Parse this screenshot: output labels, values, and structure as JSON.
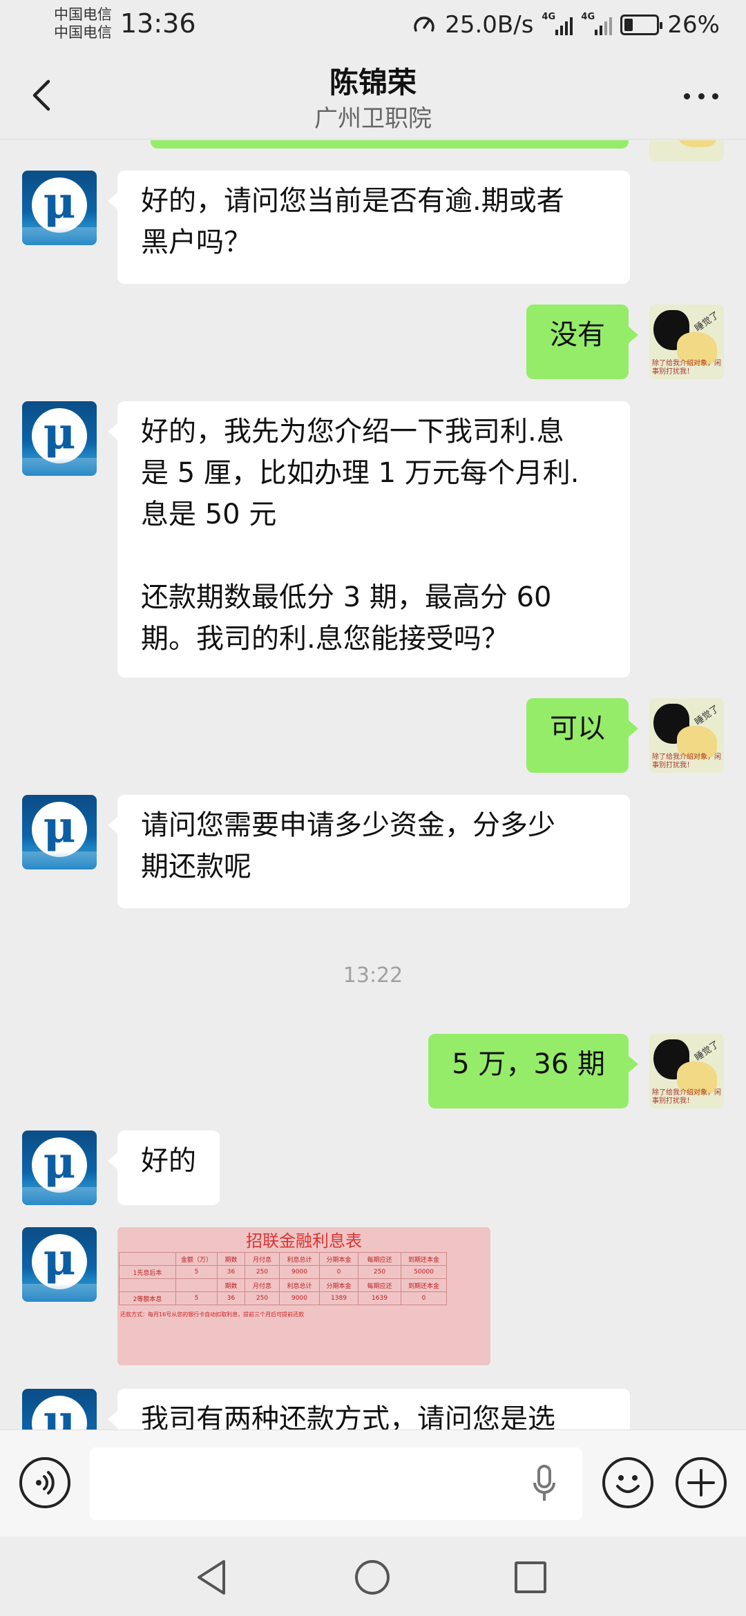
{
  "status_bar": {
    "carrier1": "中国电信",
    "carrier2": "中国电信",
    "time": "13:36",
    "speed": "25.0B/s",
    "network1": "4G",
    "network2": "4G",
    "battery": "26%",
    "battery_level": 0.26
  },
  "header": {
    "title": "陈锦荣",
    "subtitle": "广州卫职院"
  },
  "avatars": {
    "contact_glyph": "μ",
    "user_caption": "除了给我介绍对象，闲事别打扰我！",
    "user_sticker_text": "睡觉了"
  },
  "messages": [
    {
      "side": "left",
      "text": "好的，请问您当前是否有逾.期或者\n黑户吗？"
    },
    {
      "side": "right",
      "text": "没有"
    },
    {
      "side": "left",
      "text": "好的，我先为您介绍一下我司利.息\n是 5 厘，比如办理 1 万元每个月利.\n息是 50 元\n\n还款期数最低分 3 期，最高分 60\n期。我司的利.息您能接受吗？"
    },
    {
      "side": "right",
      "text": "可以"
    },
    {
      "side": "left",
      "text": "请问您需要申请多少资金，分多少\n期还款呢"
    },
    {
      "side": "time",
      "text": "13:22"
    },
    {
      "side": "right",
      "text": "5 万，36 期"
    },
    {
      "side": "left",
      "text": "好的"
    },
    {
      "side": "left",
      "text": "我司有两种还款方式，请问您是选"
    }
  ],
  "rate_image": {
    "title": "招联金融利息表",
    "header_row": [
      "",
      "金额（万）",
      "期数",
      "月付息",
      "利息总计",
      "分期本金",
      "每期应还",
      "到期还本金"
    ],
    "row1": [
      "1先息后本",
      "5",
      "36",
      "250",
      "9000",
      "0",
      "250",
      "50000"
    ],
    "header_row2": [
      "",
      "",
      "期数",
      "月付息",
      "利息总计",
      "分期本金",
      "每期应还",
      "到期还本金"
    ],
    "row2": [
      "2等额本息",
      "5",
      "36",
      "250",
      "9000",
      "1389",
      "1639",
      "0"
    ],
    "note": "还款方式：每月16号从您的银行卡自动扣取利息，提前三个月后可提前还款"
  },
  "input_bar": {
    "placeholder": ""
  }
}
